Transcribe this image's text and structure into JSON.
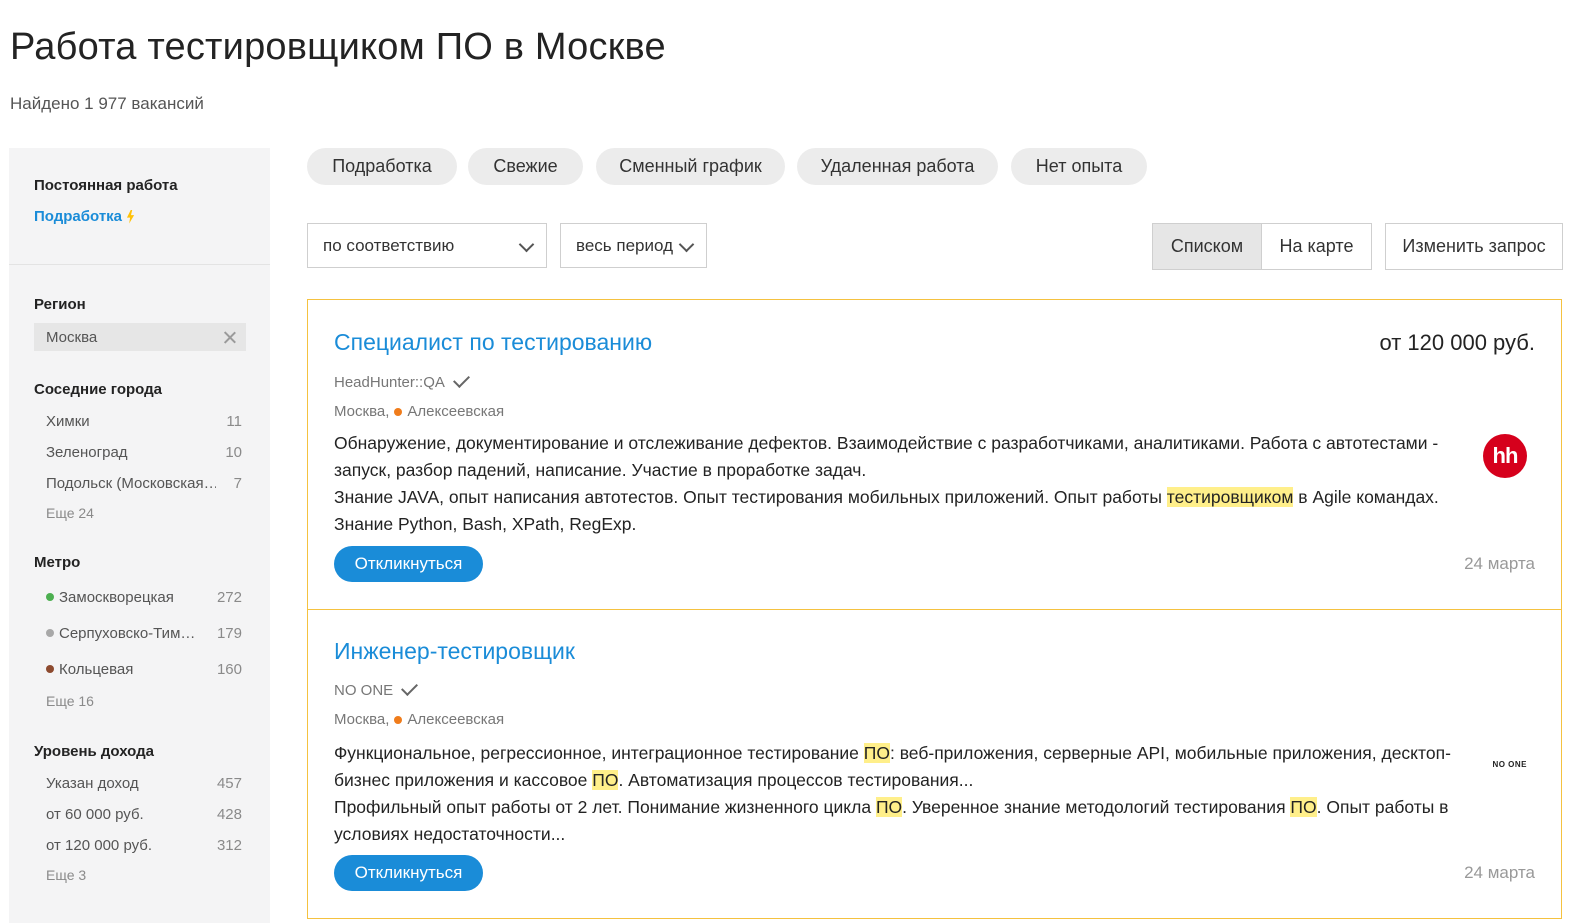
{
  "header": {
    "title": "Работа тестировщиком ПО в Москве",
    "found": "Найдено 1 977 вакансий"
  },
  "sidebar": {
    "employment": {
      "heading": "Постоянная работа",
      "link": "Подработка"
    },
    "region": {
      "heading": "Регион",
      "value": "Москва"
    },
    "nearby": {
      "heading": "Соседние города",
      "items": [
        {
          "label": "Химки",
          "count": "11"
        },
        {
          "label": "Зеленоград",
          "count": "10"
        },
        {
          "label": "Подольск (Московская…",
          "count": "7"
        }
      ],
      "more": "Еще 24"
    },
    "metro": {
      "heading": "Метро",
      "items": [
        {
          "label": "Замоскворецкая",
          "count": "272",
          "color": "#4caf50"
        },
        {
          "label": "Серпуховско-Тим…",
          "count": "179",
          "color": "#a8a8a8"
        },
        {
          "label": "Кольцевая",
          "count": "160",
          "color": "#8d4a2f"
        }
      ],
      "more": "Еще 16"
    },
    "income": {
      "heading": "Уровень дохода",
      "items": [
        {
          "label": "Указан доход",
          "count": "457"
        },
        {
          "label": "от 60 000 руб.",
          "count": "428"
        },
        {
          "label": "от 120 000 руб.",
          "count": "312"
        }
      ],
      "more": "Еще 3"
    }
  },
  "quick_filters": [
    "Подработка",
    "Свежие",
    "Сменный график",
    "Удаленная работа",
    "Нет опыта"
  ],
  "controls": {
    "sort": "по соответствию",
    "period": "весь период",
    "view_list": "Списком",
    "view_map": "На карте",
    "change_query": "Изменить запрос"
  },
  "vacancies": [
    {
      "title": "Специалист по тестированию",
      "salary": "от 120 000 руб.",
      "company": "HeadHunter::QA",
      "city": "Москва,",
      "metro": "Алексеевская",
      "metro_color": "#f07c1b",
      "logo": "hh",
      "desc_1": "Обнаружение, документирование и отслеживание дефектов. Взаимодействие с разработчиками, аналитиками. Работа с автотестами - запуск, разбор падений, написание. Участие в проработке задач.",
      "desc_2_a": "Знание JAVA, опыт написания автотестов. Опыт тестирования мобильных приложений. Опыт работы ",
      "desc_2_hl": "тестировщиком",
      "desc_2_b": " в Agile командах. Знание Python, Bash, XPath, RegExp.",
      "respond": "Откликнуться",
      "date": "24 марта"
    },
    {
      "title": "Инженер-тестировщик",
      "company": "NO ONE",
      "city": "Москва,",
      "metro": "Алексеевская",
      "metro_color": "#f07c1b",
      "logo": "NO ONE",
      "desc_1_a": "Функциональное, регрессионное, интеграционное тестирование ",
      "hl": "ПО",
      "desc_1_b": ": веб-приложения, серверные API, мобильные приложения, десктоп-бизнес приложения и кассовое ",
      "desc_1_c": ". Автоматизация процессов тестирования...",
      "desc_2_a": "Профильный опыт работы от 2 лет. Понимание жизненного цикла ",
      "desc_2_b": ". Уверенное знание методологий тестирования ",
      "desc_2_c": ". Опыт работы в условиях недостаточности...",
      "respond": "Откликнуться",
      "date": "24 марта"
    }
  ]
}
